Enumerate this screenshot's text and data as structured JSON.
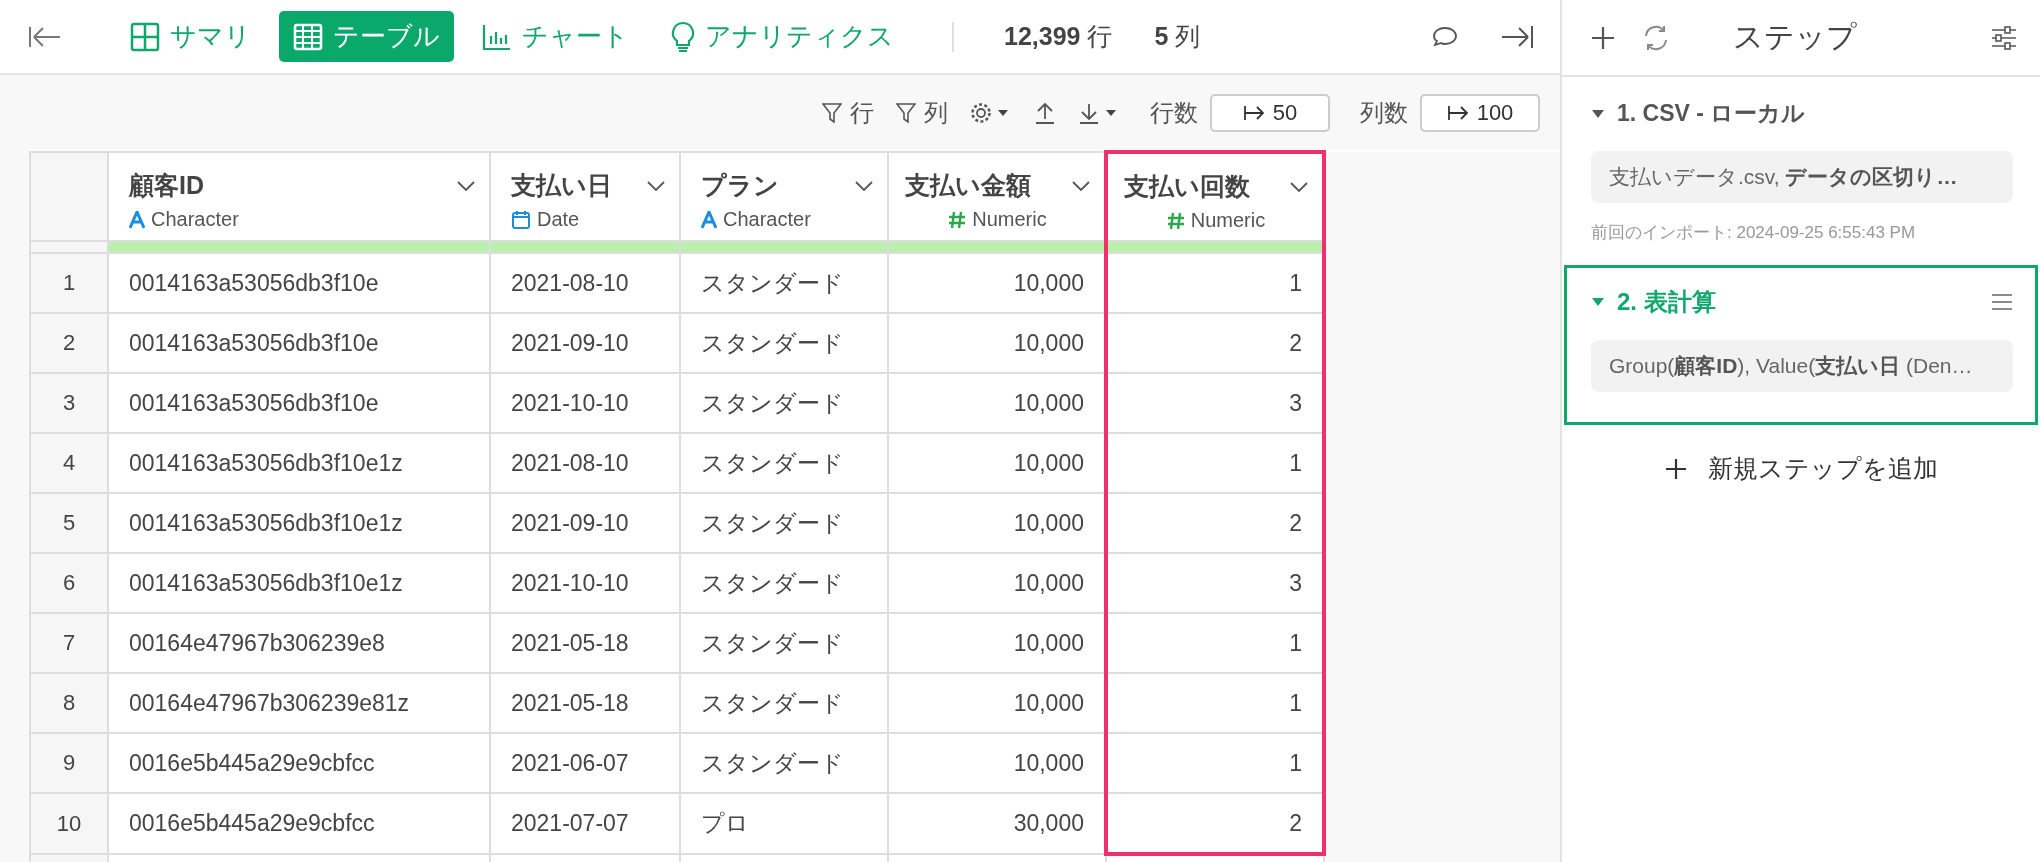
{
  "toolbar": {
    "tabs": [
      {
        "label": "サマリ",
        "selected": false
      },
      {
        "label": "テーブル",
        "selected": true
      },
      {
        "label": "チャート",
        "selected": false
      },
      {
        "label": "アナリティクス",
        "selected": false
      }
    ],
    "row_count": "12,399",
    "row_unit": "行",
    "col_count": "5",
    "col_unit": "列"
  },
  "table_toolbar": {
    "row_filter": "行",
    "col_filter": "列",
    "rows_label": "行数",
    "rows_value": "50",
    "cols_label": "列数",
    "cols_value": "100"
  },
  "table": {
    "columns": [
      {
        "name": "顧客ID",
        "type": "Character",
        "kind": "character",
        "highlighted": false
      },
      {
        "name": "支払い日",
        "type": "Date",
        "kind": "date",
        "highlighted": false
      },
      {
        "name": "プラン",
        "type": "Character",
        "kind": "character",
        "highlighted": false
      },
      {
        "name": "支払い金額",
        "type": "Numeric",
        "kind": "numeric",
        "highlighted": false
      },
      {
        "name": "支払い回数",
        "type": "Numeric",
        "kind": "numeric",
        "highlighted": true
      }
    ],
    "rows": [
      {
        "number": "1",
        "cells": [
          "0014163a53056db3f10e",
          "2021-08-10",
          "スタンダード",
          "10,000",
          "1"
        ]
      },
      {
        "number": "2",
        "cells": [
          "0014163a53056db3f10e",
          "2021-09-10",
          "スタンダード",
          "10,000",
          "2"
        ]
      },
      {
        "number": "3",
        "cells": [
          "0014163a53056db3f10e",
          "2021-10-10",
          "スタンダード",
          "10,000",
          "3"
        ]
      },
      {
        "number": "4",
        "cells": [
          "0014163a53056db3f10e1z",
          "2021-08-10",
          "スタンダード",
          "10,000",
          "1"
        ]
      },
      {
        "number": "5",
        "cells": [
          "0014163a53056db3f10e1z",
          "2021-09-10",
          "スタンダード",
          "10,000",
          "2"
        ]
      },
      {
        "number": "6",
        "cells": [
          "0014163a53056db3f10e1z",
          "2021-10-10",
          "スタンダード",
          "10,000",
          "3"
        ]
      },
      {
        "number": "7",
        "cells": [
          "00164e47967b306239e8",
          "2021-05-18",
          "スタンダード",
          "10,000",
          "1"
        ]
      },
      {
        "number": "8",
        "cells": [
          "00164e47967b306239e81z",
          "2021-05-18",
          "スタンダード",
          "10,000",
          "1"
        ]
      },
      {
        "number": "9",
        "cells": [
          "0016e5b445a29e9cbfcc",
          "2021-06-07",
          "スタンダード",
          "10,000",
          "1"
        ]
      },
      {
        "number": "10",
        "cells": [
          "0016e5b445a29e9cbfcc",
          "2021-07-07",
          "プロ",
          "30,000",
          "2"
        ]
      }
    ]
  },
  "steps_panel": {
    "title": "ステップ",
    "steps": [
      {
        "title": "1. CSV - ローカル",
        "summary": "支払いデータ.csv, **データの区切り…**",
        "last_import": "前回のインポート: 2024-09-25 6:55:43 PM",
        "selected": false
      },
      {
        "title": "2. 表計算",
        "summary": "Group(**顧客ID**), Value(**支払い日** (Den…",
        "selected": true
      }
    ],
    "add_step": "新規ステップを追加"
  }
}
